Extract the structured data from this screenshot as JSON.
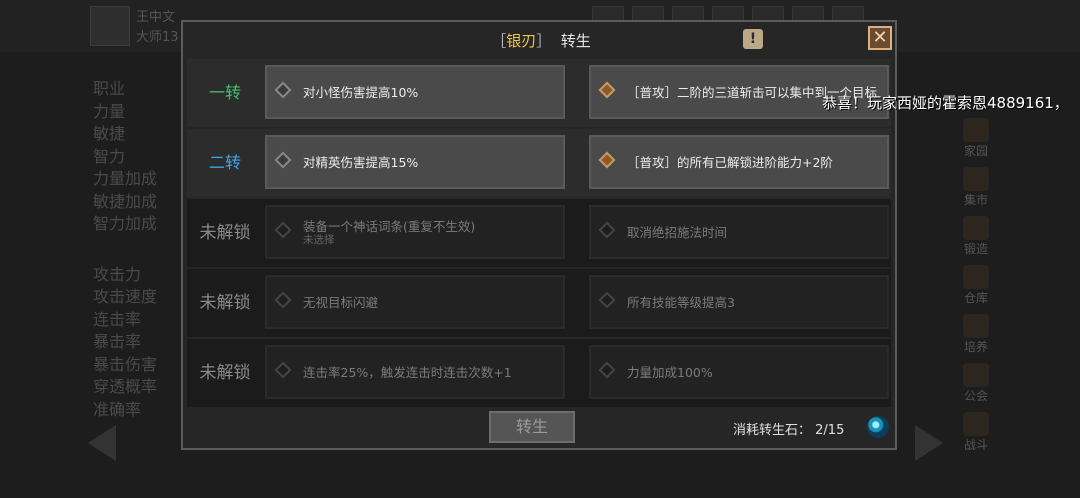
{
  "background": {
    "player_name": "王中文",
    "player_rank": "大师13",
    "stats": [
      "职业",
      "力量",
      "敏捷",
      "智力",
      "力量加成",
      "敏捷加成",
      "智力加成"
    ],
    "battle_stats": [
      "攻击力",
      "攻击速度",
      "连击率",
      "暴击率",
      "暴击伤害",
      "穿透概率",
      "准确率"
    ],
    "nav": [
      {
        "label": "家园",
        "icon": "home-icon"
      },
      {
        "label": "集市",
        "icon": "market-icon"
      },
      {
        "label": "锻造",
        "icon": "anvil-icon"
      },
      {
        "label": "仓库",
        "icon": "warehouse-icon"
      },
      {
        "label": "培养",
        "icon": "cultivate-icon"
      },
      {
        "label": "公会",
        "icon": "guild-icon"
      },
      {
        "label": "战斗",
        "icon": "battle-icon"
      }
    ],
    "broadcast": "恭喜！玩家西娅的霍索恩4889161，"
  },
  "dialog": {
    "title_open": "［",
    "title_weapon": "银刃",
    "title_close": "］",
    "title_main": "转生",
    "info_label": "!",
    "close_label": "✕",
    "rows": [
      {
        "label": "一转",
        "state": "unlocked",
        "left": {
          "text": "对小怪伤害提高10%",
          "sub": ""
        },
        "right": {
          "text": "［普攻］二阶的三道斩击可以集中到一个目标",
          "sub": ""
        }
      },
      {
        "label": "二转",
        "state": "unlocked",
        "left": {
          "text": "对精英伤害提高15%",
          "sub": ""
        },
        "right": {
          "text": "［普攻］的所有已解锁进阶能力+2阶",
          "sub": ""
        }
      },
      {
        "label": "未解锁",
        "state": "locked",
        "left": {
          "text": "装备一个神话词条(重复不生效)",
          "sub": "未选择"
        },
        "right": {
          "text": "取消绝招施法时间",
          "sub": ""
        }
      },
      {
        "label": "未解锁",
        "state": "locked",
        "left": {
          "text": "无视目标闪避",
          "sub": ""
        },
        "right": {
          "text": "所有技能等级提高3",
          "sub": ""
        }
      },
      {
        "label": "未解锁",
        "state": "locked",
        "left": {
          "text": "连击率25%，触发连击时连击次数+1",
          "sub": ""
        },
        "right": {
          "text": "力量加成100%",
          "sub": ""
        }
      }
    ],
    "rebirth_button": "转生",
    "cost_label": "消耗转生石：",
    "cost_value": "2/15",
    "gem_icon": "rebirth-stone-icon",
    "colors": {
      "first": "#42c16a",
      "second": "#3aa6e6",
      "weapon": "#e8c64a"
    }
  }
}
